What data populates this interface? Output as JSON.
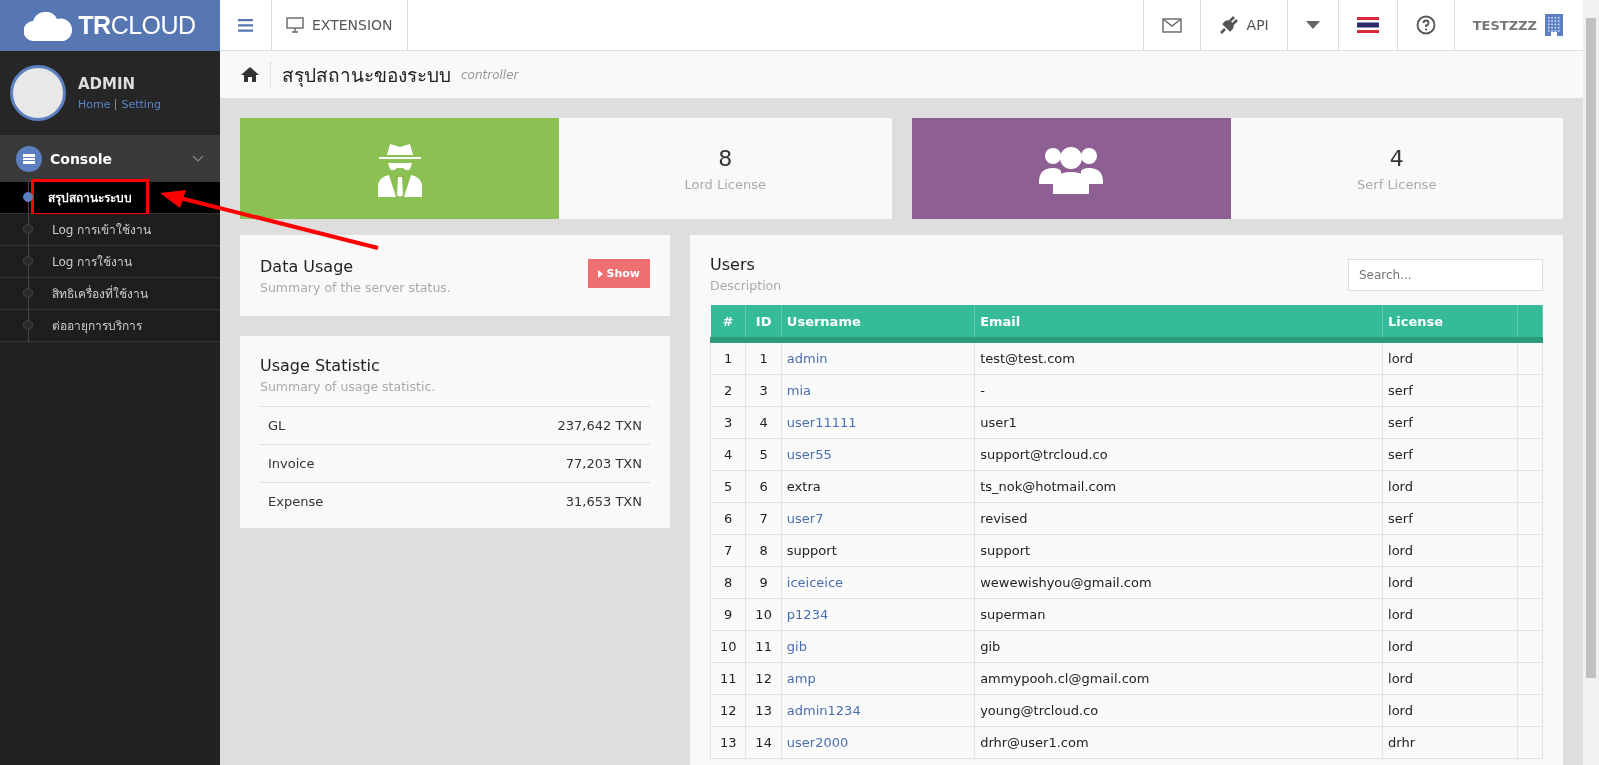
{
  "brand": {
    "name_bold": "TR",
    "name_light": "CLOUD"
  },
  "topbar": {
    "extension": "EXTENSION",
    "api": "API",
    "user": "TESTZZZ"
  },
  "profile": {
    "name": "ADMIN",
    "links": [
      "Home",
      "Setting"
    ]
  },
  "sidebar": {
    "section": "Console",
    "expanded": true,
    "items": [
      {
        "label": "สรุปสถานะระบบ",
        "selected": true,
        "annotated": true
      },
      {
        "label": "Log การเข้าใช้งาน",
        "selected": false,
        "annotated": false
      },
      {
        "label": "Log การใช้งาน",
        "selected": false,
        "annotated": false
      },
      {
        "label": "สิทธิเครื่องที่ใช้งาน",
        "selected": false,
        "annotated": false
      },
      {
        "label": "ต่ออายุการบริการ",
        "selected": false,
        "annotated": false
      }
    ]
  },
  "page": {
    "title": "สรุปสถานะของระบบ",
    "subtitle": "controller"
  },
  "licenses": [
    {
      "kind": "lord",
      "count": "8",
      "label": "Lord License"
    },
    {
      "kind": "serf",
      "count": "4",
      "label": "Serf License"
    }
  ],
  "data_usage": {
    "title": "Data Usage",
    "subtitle": "Summary of the server status.",
    "button": "Show"
  },
  "usage_statistic": {
    "title": "Usage Statistic",
    "subtitle": "Summary of usage statistic.",
    "rows": [
      {
        "label": "GL",
        "value": "237,642 TXN"
      },
      {
        "label": "Invoice",
        "value": "77,203 TXN"
      },
      {
        "label": "Expense",
        "value": "31,653 TXN"
      }
    ]
  },
  "users": {
    "title": "Users",
    "description": "Description",
    "search": {
      "placeholder": "Search..."
    },
    "columns": [
      "#",
      "ID",
      "Username",
      "Email",
      "License"
    ],
    "rows": [
      {
        "cells": [
          "1",
          "1",
          "admin",
          "test@test.com",
          "lord"
        ],
        "linked": true
      },
      {
        "cells": [
          "2",
          "3",
          "mia",
          "-",
          "serf"
        ],
        "linked": true
      },
      {
        "cells": [
          "3",
          "4",
          "user11111",
          "user1",
          "serf"
        ],
        "linked": true
      },
      {
        "cells": [
          "4",
          "5",
          "user55",
          "support@trcloud.co",
          "serf"
        ],
        "linked": true
      },
      {
        "cells": [
          "5",
          "6",
          "extra",
          "ts_nok@hotmail.com",
          "lord"
        ],
        "linked": false
      },
      {
        "cells": [
          "6",
          "7",
          "user7",
          "revised",
          "serf"
        ],
        "linked": true
      },
      {
        "cells": [
          "7",
          "8",
          "support",
          "support",
          "lord"
        ],
        "linked": false
      },
      {
        "cells": [
          "8",
          "9",
          "iceiceice",
          "wewewishyou@gmail.com",
          "lord"
        ],
        "linked": true
      },
      {
        "cells": [
          "9",
          "10",
          "p1234",
          "superman",
          "lord"
        ],
        "linked": true
      },
      {
        "cells": [
          "10",
          "11",
          "gib",
          "gib",
          "lord"
        ],
        "linked": true
      },
      {
        "cells": [
          "11",
          "12",
          "amp",
          "ammypooh.cl@gmail.com",
          "lord"
        ],
        "linked": true
      },
      {
        "cells": [
          "12",
          "13",
          "admin1234",
          "young@trcloud.co",
          "lord"
        ],
        "linked": true
      },
      {
        "cells": [
          "13",
          "14",
          "user2000",
          "drhr@user1.com",
          "drhr"
        ],
        "linked": true
      }
    ]
  }
}
